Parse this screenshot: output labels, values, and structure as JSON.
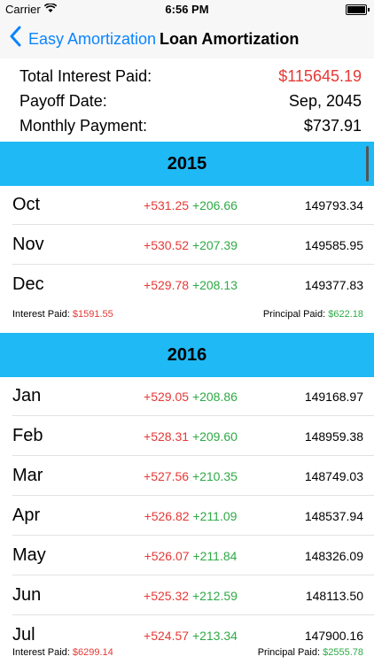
{
  "status": {
    "carrier": "Carrier",
    "time": "6:56 PM",
    "wifi_icon": "wifi-icon",
    "battery_icon": "battery-icon"
  },
  "nav": {
    "back_label": "Easy Amortization",
    "title": "Loan Amortization",
    "back_icon": "chevron-left-icon"
  },
  "summary": {
    "interest_label": "Total Interest Paid:",
    "interest_value": "$115645.19",
    "payoff_label": "Payoff Date:",
    "payoff_value": "Sep, 2045",
    "monthly_label": "Monthly Payment:",
    "monthly_value": "$737.91"
  },
  "years": [
    {
      "year": "2015",
      "months": [
        {
          "month": "Oct",
          "interest": "+531.25",
          "principal": "+206.66",
          "balance": "149793.34"
        },
        {
          "month": "Nov",
          "interest": "+530.52",
          "principal": "+207.39",
          "balance": "149585.95"
        },
        {
          "month": "Dec",
          "interest": "+529.78",
          "principal": "+208.13",
          "balance": "149377.83"
        }
      ],
      "interest_paid_label": "Interest Paid:",
      "interest_paid": "$1591.55",
      "principal_paid_label": "Principal Paid:",
      "principal_paid": "$622.18"
    },
    {
      "year": "2016",
      "months": [
        {
          "month": "Jan",
          "interest": "+529.05",
          "principal": "+208.86",
          "balance": "149168.97"
        },
        {
          "month": "Feb",
          "interest": "+528.31",
          "principal": "+209.60",
          "balance": "148959.38"
        },
        {
          "month": "Mar",
          "interest": "+527.56",
          "principal": "+210.35",
          "balance": "148749.03"
        },
        {
          "month": "Apr",
          "interest": "+526.82",
          "principal": "+211.09",
          "balance": "148537.94"
        },
        {
          "month": "May",
          "interest": "+526.07",
          "principal": "+211.84",
          "balance": "148326.09"
        },
        {
          "month": "Jun",
          "interest": "+525.32",
          "principal": "+212.59",
          "balance": "148113.50"
        },
        {
          "month": "Jul",
          "interest": "+524.57",
          "principal": "+213.34",
          "balance": "147900.16"
        }
      ],
      "interest_paid_label": "Interest Paid:",
      "interest_paid": "$6299.14",
      "principal_paid_label": "Principal Paid:",
      "principal_paid": "$2555.78"
    }
  ],
  "colors": {
    "accent": "#0a84ff",
    "year_header": "#1fb9f5",
    "interest": "#e53935",
    "principal": "#2eaa46"
  }
}
